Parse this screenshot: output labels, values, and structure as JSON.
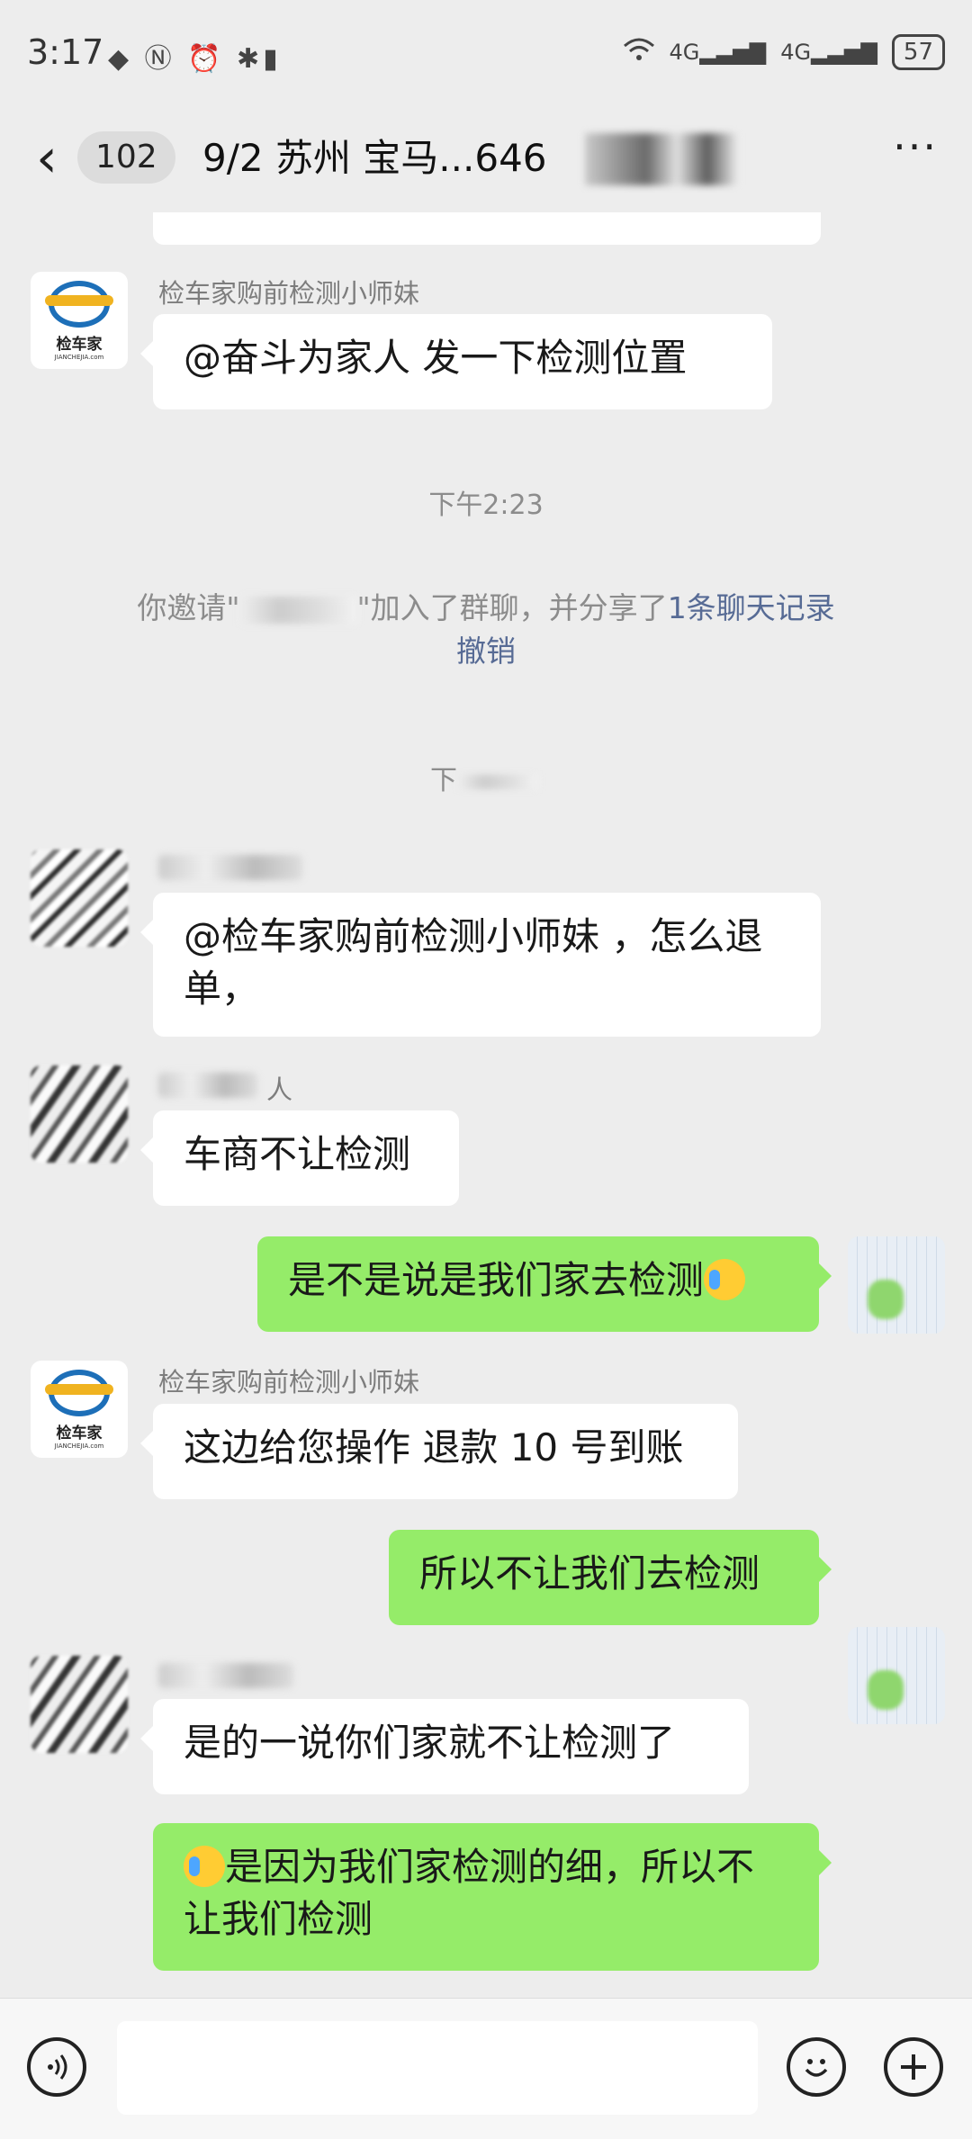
{
  "status_bar": {
    "time": "3:17",
    "left_icons": "◆ Ⓝ ⏰ ✱▮",
    "net1": "4G",
    "net2": "4G",
    "battery": "57"
  },
  "header": {
    "back_glyph": "‹",
    "unread_count": "102",
    "title": "9/2 苏州 宝马...646",
    "more_glyph": "···"
  },
  "messages": {
    "m1": {
      "sender": "检车家购前检测小师妹",
      "text": "@奋斗为家人  发一下检测位置"
    },
    "t1": "下午2:23",
    "sys1": {
      "before": "你邀请\"",
      "after": "\"加入了群聊，并分享了",
      "link1": "1条聊天记录",
      "link2": "撤销"
    },
    "t2": "下",
    "m2": {
      "text": "@检车家购前检测小师妹 ，怎么退单，"
    },
    "m3": {
      "sender_tail": "人",
      "text": "车商不让检测"
    },
    "m4": {
      "text": "是不是说是我们家去检测"
    },
    "m5": {
      "sender": "检车家购前检测小师妹",
      "text": "这边给您操作 退款 10 号到账"
    },
    "m6": {
      "text": "所以不让我们去检测"
    },
    "m7": {
      "text": "是的一说你们家就不让检测了"
    },
    "m8": {
      "text": "是因为我们家检测的细，所以不让我们检测"
    }
  },
  "logo": {
    "brand": "检车家",
    "domain": "JIANCHEJIA.com"
  },
  "input_bar": {
    "voice_icon": "voice-icon",
    "emoji_icon": "emoji-icon",
    "plus_icon": "plus-icon"
  },
  "colors": {
    "out_bubble": "#95ec69",
    "link": "#576b95",
    "background": "#ededed"
  }
}
